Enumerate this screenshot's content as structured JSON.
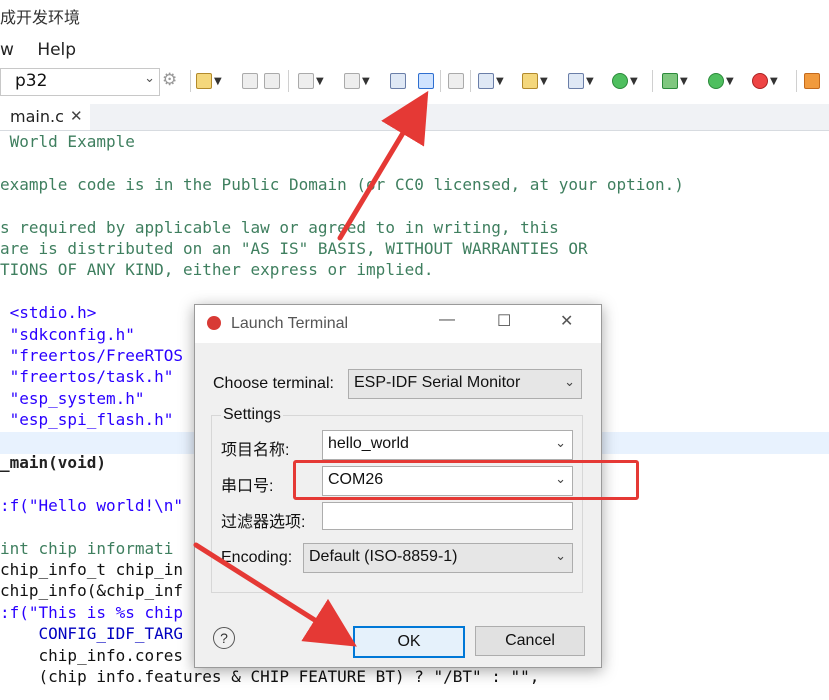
{
  "window": {
    "title": "成开发环境"
  },
  "menubar": {
    "items": [
      "w",
      "Help"
    ]
  },
  "toolbar": {
    "target_combo": "p32"
  },
  "editor": {
    "tab_label": "main.c",
    "lines": [
      {
        "text": " World Example",
        "kind": "cm"
      },
      {
        "text": "",
        "kind": "bl"
      },
      {
        "text": "example code is in the Public Domain (or CC0 licensed, at your option.)",
        "kind": "cm"
      },
      {
        "text": "",
        "kind": "bl"
      },
      {
        "text": "s required by applicable law or agreed to in writing, this",
        "kind": "cm"
      },
      {
        "text": "are is distributed on an \"AS IS\" BASIS, WITHOUT WARRANTIES OR",
        "kind": "cm"
      },
      {
        "text": "TIONS OF ANY KIND, either express or implied.",
        "kind": "cm"
      },
      {
        "text": "",
        "kind": "bl"
      },
      {
        "text": " <stdio.h>",
        "kind": "inc"
      },
      {
        "text": " \"sdkconfig.h\"",
        "kind": "inc"
      },
      {
        "text": " \"freertos/FreeRTOS",
        "kind": "inc"
      },
      {
        "text": " \"freertos/task.h\"",
        "kind": "inc"
      },
      {
        "text": " \"esp_system.h\"",
        "kind": "inc"
      },
      {
        "text": " \"esp_spi_flash.h\"",
        "kind": "inc"
      },
      {
        "text": "",
        "kind": "bl"
      },
      {
        "text": "_main(void)",
        "kind": "fn"
      },
      {
        "text": "",
        "kind": "bl"
      },
      {
        "text": ":f(\"Hello world!\\n\"",
        "kind": "str"
      },
      {
        "text": "",
        "kind": "bl"
      },
      {
        "text": "int chip informati",
        "kind": "cm"
      },
      {
        "text": "chip_info_t chip_in",
        "kind": "bl"
      },
      {
        "text": "chip_info(&chip_inf",
        "kind": "bl"
      },
      {
        "text": ":f(\"This is %s chip",
        "kind": "str"
      },
      {
        "text": "    CONFIG_IDF_TARG",
        "kind": "macro"
      },
      {
        "text": "    chip_info.cores",
        "kind": "bl"
      },
      {
        "text": "    (chip info.features & CHIP FEATURE BT) ? \"/BT\" : \"\",",
        "kind": "bl"
      }
    ]
  },
  "dialog": {
    "title": "Launch Terminal",
    "choose_terminal_label": "Choose terminal:",
    "choose_terminal_value": "ESP-IDF Serial Monitor",
    "settings_label": "Settings",
    "project_label": "项目名称:",
    "project_value": "hello_world",
    "port_label": "串口号:",
    "port_value": "COM26",
    "filter_label": "过滤器选项:",
    "filter_value": "",
    "encoding_label": "Encoding:",
    "encoding_value": "Default (ISO-8859-1)",
    "ok_label": "OK",
    "cancel_label": "Cancel",
    "help_glyph": "?"
  },
  "annotation_color": "#e53935"
}
